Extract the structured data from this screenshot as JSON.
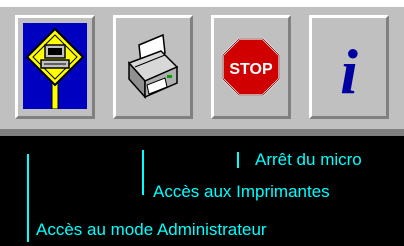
{
  "toolbar": {
    "buttons": [
      {
        "id": "admin",
        "icon": "admin-computer-sign-icon"
      },
      {
        "id": "printers",
        "icon": "printer-icon"
      },
      {
        "id": "stop",
        "icon": "stop-sign-icon",
        "icon_text": "STOP"
      },
      {
        "id": "info",
        "icon": "info-icon",
        "icon_text": "i"
      }
    ]
  },
  "captions": {
    "stop": "Arrêt du micro",
    "printers": "Accès aux Imprimantes",
    "admin": "Accès au mode Administrateur"
  },
  "colors": {
    "toolbar_bg": "#c0c0c0",
    "caption_bg": "#000000",
    "caption_text": "#00ffff",
    "stop_red": "#d00000",
    "info_blue": "#0000a0",
    "admin_blue": "#0000c0",
    "admin_yellow": "#ffff00"
  }
}
